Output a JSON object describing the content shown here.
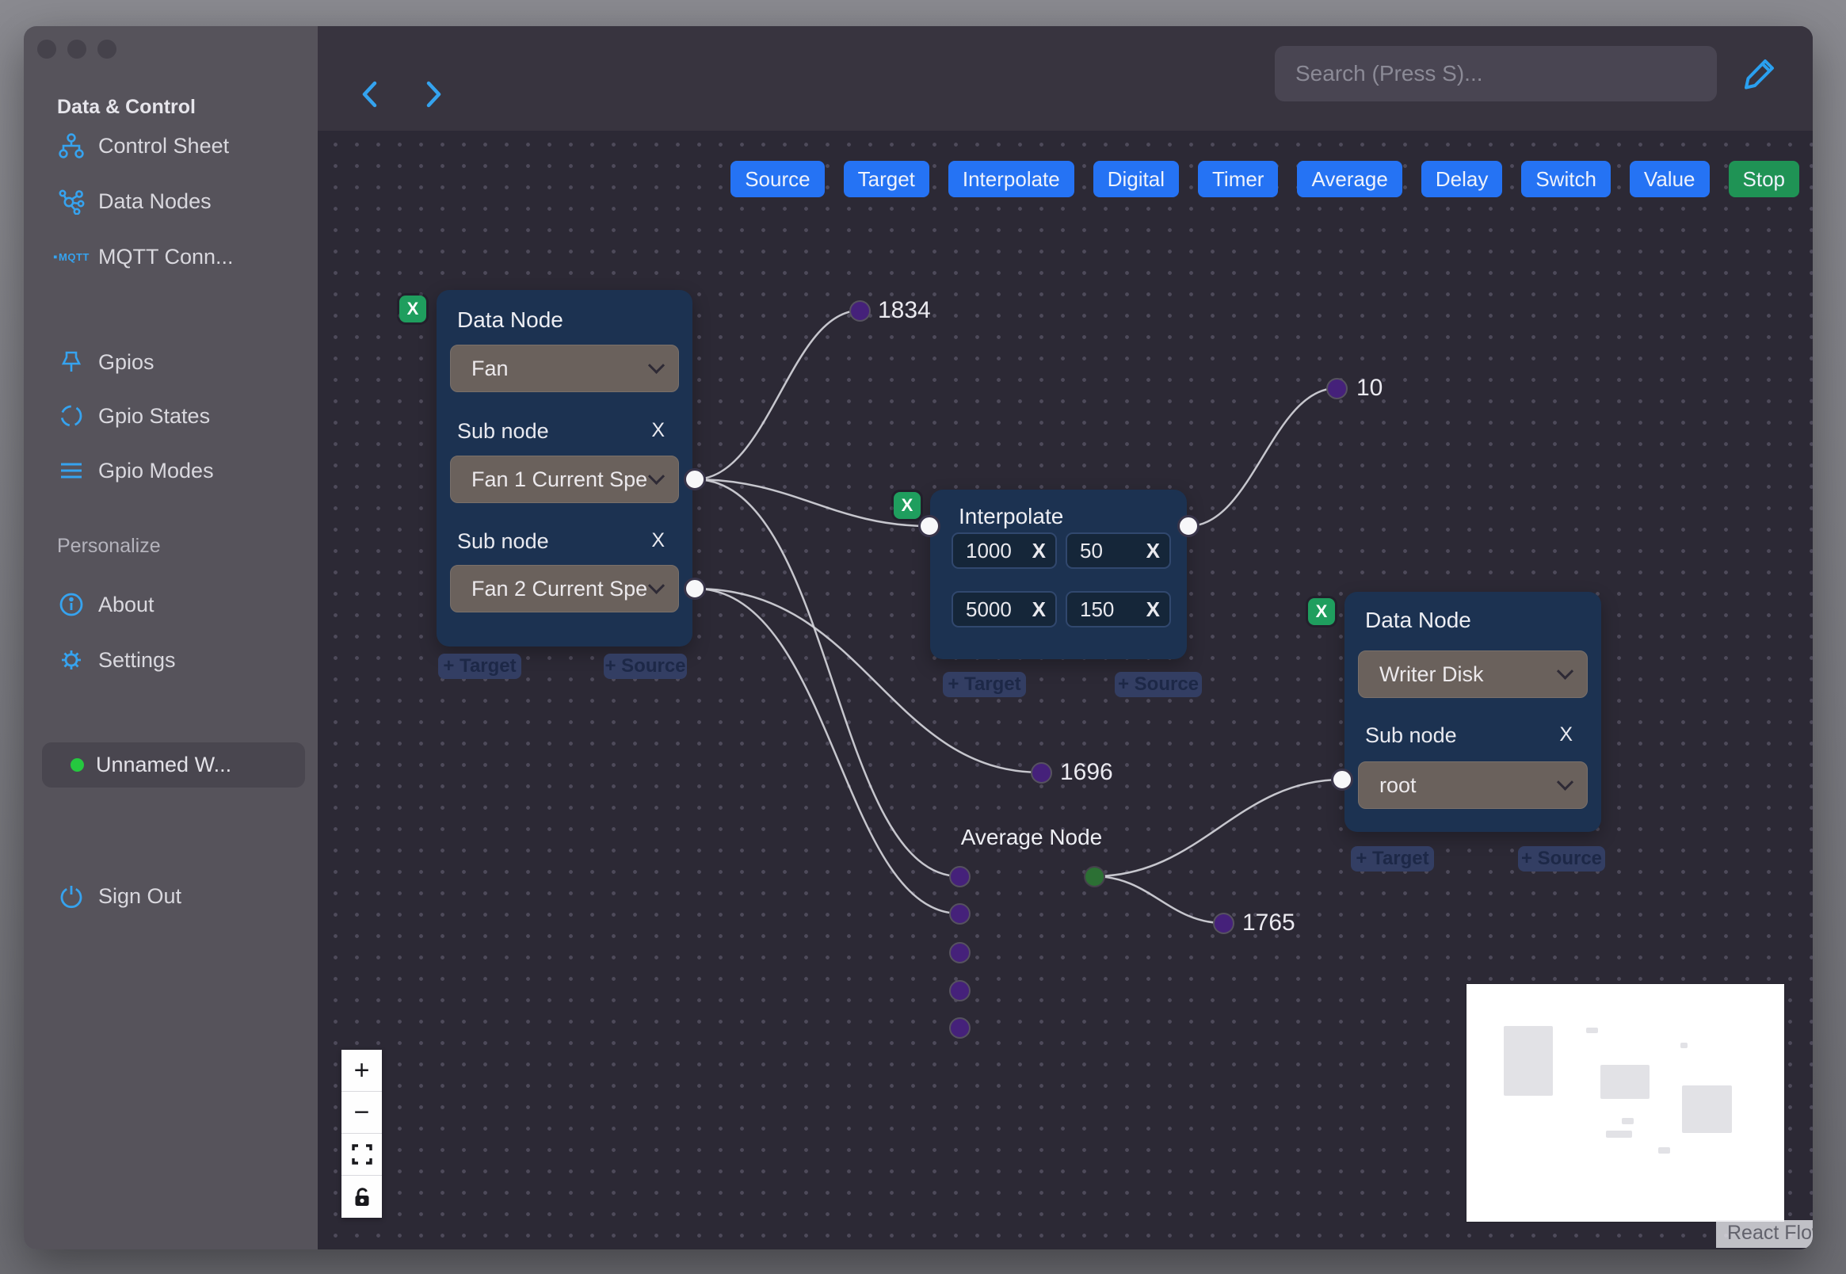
{
  "sidebar": {
    "header_data_control": "Data & Control",
    "header_personalize": "Personalize",
    "items": [
      {
        "label": "Control Sheet"
      },
      {
        "label": "Data Nodes"
      },
      {
        "label": "MQTT Conn..."
      },
      {
        "label": "Gpios"
      },
      {
        "label": "Gpio States"
      },
      {
        "label": "Gpio Modes"
      },
      {
        "label": "About"
      },
      {
        "label": "Settings"
      }
    ],
    "mqtt_icon_text": "MQTT",
    "workspace": {
      "label": "Unnamed W..."
    },
    "sign_out": {
      "label": "Sign Out"
    }
  },
  "topbar": {
    "search_placeholder": "Search (Press S)..."
  },
  "palette": {
    "buttons": [
      {
        "label": "Source"
      },
      {
        "label": "Target"
      },
      {
        "label": "Interpolate"
      },
      {
        "label": "Digital"
      },
      {
        "label": "Timer"
      },
      {
        "label": "Average"
      },
      {
        "label": "Delay"
      },
      {
        "label": "Switch"
      },
      {
        "label": "Value"
      },
      {
        "label": "Stop"
      }
    ]
  },
  "nodes": {
    "fan": {
      "title": "Data Node",
      "type_value": "Fan",
      "sub_label": "Sub node",
      "sub_value_1": "Fan 1 Current Spe",
      "sub_value_2": "Fan 2 Current Spe",
      "remove_label": "X",
      "target_badge": "+ Target",
      "source_badge": "+ Source"
    },
    "interpolate": {
      "title": "Interpolate",
      "rows": [
        {
          "x": "1000",
          "y": "50"
        },
        {
          "x": "5000",
          "y": "150"
        }
      ],
      "remove_label": "X",
      "target_badge": "+ Target",
      "source_badge": "+ Source"
    },
    "writer": {
      "title": "Data Node",
      "type_value": "Writer Disk",
      "sub_label": "Sub node",
      "sub_value": "root",
      "remove_label": "X",
      "target_badge": "+ Target",
      "source_badge": "+ Source"
    },
    "average": {
      "title": "Average Node"
    }
  },
  "edge_labels": [
    {
      "value": "1834"
    },
    {
      "value": "10"
    },
    {
      "value": "1696"
    },
    {
      "value": "1765"
    }
  ],
  "controls": {
    "zoom_in": "+",
    "zoom_out": "−"
  },
  "attribution": "React Flow",
  "colors": {
    "accent_blue": "#2573f4",
    "accent_green": "#1f9355",
    "icon_blue": "#36a3ef",
    "node_bg": "#1c3251",
    "handle_purple": "#45217a",
    "handle_green": "#2c7034",
    "status_green": "#25c83f"
  }
}
